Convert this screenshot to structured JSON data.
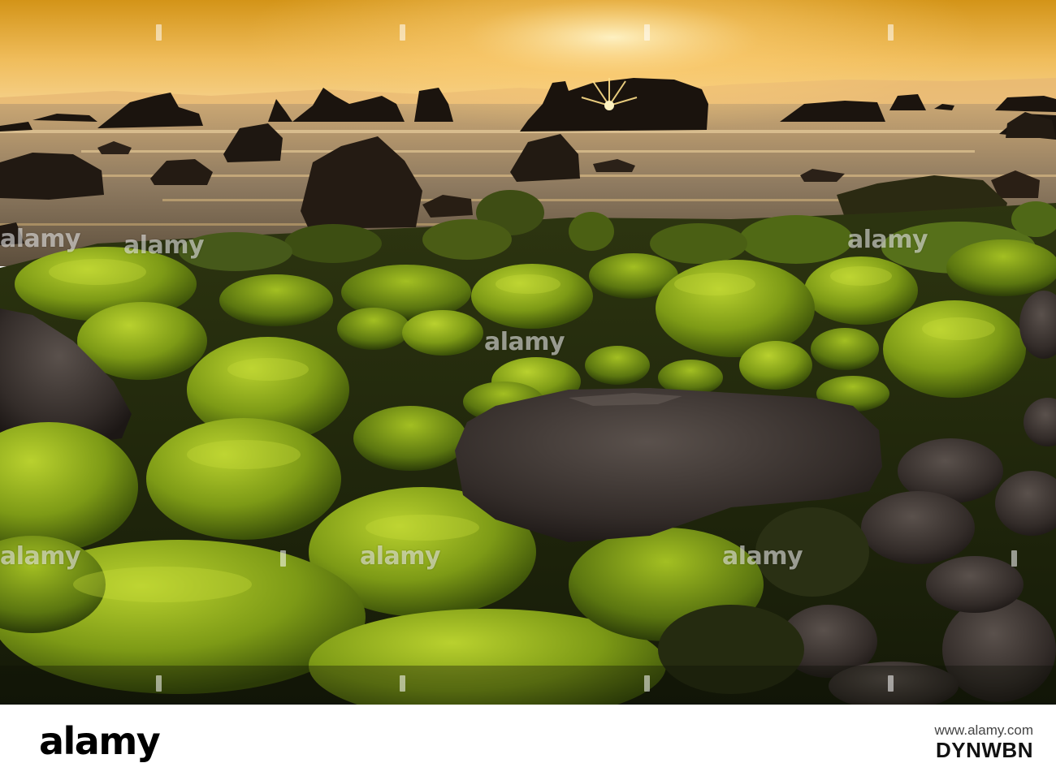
{
  "image": {
    "description_free": true,
    "colors": {
      "sky_top": "#d9a12a",
      "sky_mid": "#f2c46b",
      "horizon": "#f7d089",
      "sea": "#8d7a5e",
      "rock_dark": "#1d1812",
      "moss_bright": "#9fbf1e",
      "moss_dark": "#3f5a10",
      "boulder": "#3a3330"
    },
    "watermark_text": "alamy"
  },
  "footer": {
    "logo": "alamy",
    "stock_label": "www.alamy.com",
    "image_id": "DYNWBN"
  }
}
